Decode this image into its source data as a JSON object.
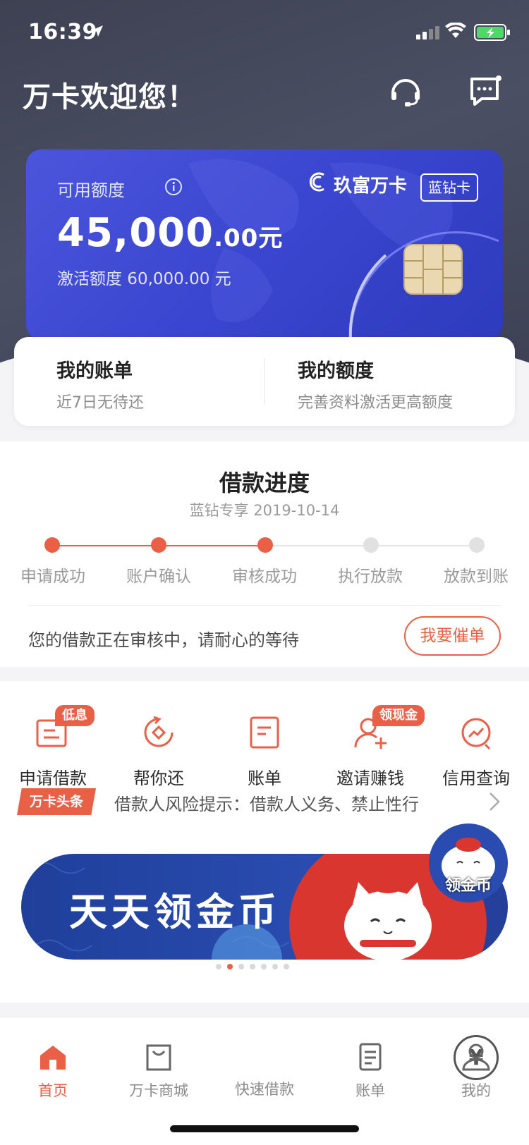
{
  "status_bar": {
    "time": "16:39"
  },
  "header": {
    "welcome": "万卡欢迎您！",
    "support_icon": "headset-icon",
    "message_icon": "chat-bubble-icon"
  },
  "card": {
    "available_label": "可用额度",
    "amount_int": "45,000",
    "amount_dec": ".00",
    "amount_unit": "元",
    "activated_label": "激活额度 60,000.00 元",
    "brand": "玖富万卡",
    "tier": "蓝钻卡",
    "colors": {
      "card": "#3a46cf",
      "accent": "#ea6046"
    }
  },
  "summary": {
    "bill": {
      "title": "我的账单",
      "sub": "近7日无待还"
    },
    "quota": {
      "title": "我的额度",
      "sub": "完善资料激活更高额度"
    }
  },
  "progress": {
    "title": "借款进度",
    "subtitle": "蓝钻专享 2019-10-14",
    "steps": [
      "申请成功",
      "账户确认",
      "审核成功",
      "执行放款",
      "放款到账"
    ],
    "completed_steps": 3,
    "message": "您的借款正在审核中，请耐心的等待",
    "urge_button": "我要催单"
  },
  "services": {
    "items": [
      {
        "label": "申请借款",
        "badge": "低息",
        "icon": "loan-apply-icon"
      },
      {
        "label": "帮你还",
        "badge": "",
        "icon": "repay-help-icon"
      },
      {
        "label": "账单",
        "badge": "",
        "icon": "bill-icon"
      },
      {
        "label": "邀请赚钱",
        "badge": "领现金",
        "icon": "invite-user-icon"
      },
      {
        "label": "信用查询",
        "badge": "",
        "icon": "credit-query-icon"
      }
    ],
    "news_tag": "万卡头条",
    "news_text": "借款人风险提示：借款人义务、禁止性行",
    "banner_title": "天天领金币",
    "banner_pages": 7,
    "banner_active": 1,
    "float_label": "领金币"
  },
  "tabbar": {
    "items": [
      {
        "label": "首页",
        "icon": "home-icon",
        "active": true
      },
      {
        "label": "万卡商城",
        "icon": "shopping-bag-icon",
        "active": false
      },
      {
        "label": "快速借款",
        "icon": "yen-coin-icon",
        "active": false
      },
      {
        "label": "账单",
        "icon": "bill-icon",
        "active": false
      },
      {
        "label": "我的",
        "icon": "profile-icon",
        "active": false
      }
    ],
    "fab_symbol": "¥"
  }
}
